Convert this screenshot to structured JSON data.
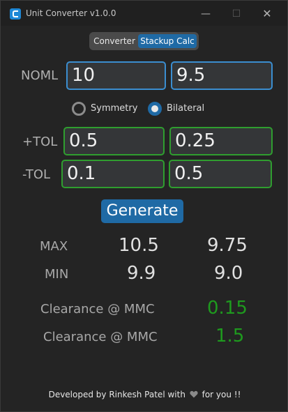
{
  "window": {
    "title": "Unit Converter v1.0.0",
    "controls": {
      "minimize": "—",
      "maximize": "☐",
      "close": "✕"
    }
  },
  "tabs": [
    {
      "label": "Converter",
      "selected": false
    },
    {
      "label": "Stackup Calc",
      "selected": true
    }
  ],
  "nominal": {
    "label": "NOML",
    "value1": "10",
    "value2": "9.5"
  },
  "mode": {
    "options": [
      {
        "label": "Symmetry",
        "selected": false
      },
      {
        "label": "Bilateral",
        "selected": true
      }
    ]
  },
  "plus_tol": {
    "label": "+TOL",
    "value1": "0.5",
    "value2": "0.25"
  },
  "minus_tol": {
    "label": "-TOL",
    "value1": "0.1",
    "value2": "0.5"
  },
  "generate_label": "Generate",
  "results": {
    "max": {
      "label": "MAX",
      "value1": "10.5",
      "value2": "9.75"
    },
    "min": {
      "label": "MIN",
      "value1": "9.9",
      "value2": "9.0"
    }
  },
  "clearance": [
    {
      "label": "Clearance @ MMC",
      "value": "0.15"
    },
    {
      "label": "Clearance @ MMC",
      "value": "1.5"
    }
  ],
  "footer": {
    "prefix": "Developed by Rinkesh Patel with",
    "suffix": "for you !!"
  },
  "colors": {
    "accent": "#1f6aa5",
    "input_border_nominal": "#3b8ed0",
    "input_border_tol": "#2f9e2f",
    "clearance_value": "#1e9a1e"
  },
  "icons": {
    "app": "app-logo-icon",
    "footer": "heart-icon"
  }
}
